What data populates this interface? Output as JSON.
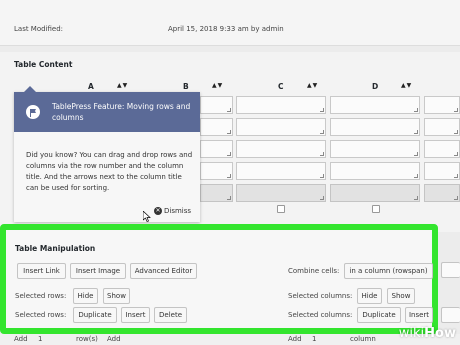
{
  "meta": {
    "last_modified_label": "Last Modified:",
    "last_modified_value": "April 15, 2018 9:33 am by admin"
  },
  "table_content": {
    "heading": "Table Content",
    "columns": [
      "A",
      "B",
      "C",
      "D"
    ],
    "sort_arrows": "▲▼"
  },
  "popup": {
    "title": "TablePress Feature: Moving rows and columns",
    "body": "Did you know? You can drag and drop rows and columns via the row number and the column title. And the arrows next to the column title can be used for sorting.",
    "dismiss": "Dismiss"
  },
  "manipulation": {
    "heading": "Table Manipulation",
    "insert_link": "Insert Link",
    "insert_image": "Insert Image",
    "advanced_editor": "Advanced Editor",
    "combine_cells_label": "Combine cells:",
    "combine_cells_button": "in a column (rowspan)",
    "selected_rows_label": "Selected rows:",
    "selected_columns_label": "Selected columns:",
    "hide": "Hide",
    "show": "Show",
    "duplicate": "Duplicate",
    "insert": "Insert",
    "delete": "Delete"
  },
  "bottom": {
    "add_label": "Add",
    "add_rows_value": "1",
    "rows_suffix": "row(s)",
    "add_button": "Add",
    "add_cols_value": "1",
    "cols_suffix": "column"
  },
  "watermark": {
    "wiki": "wiki",
    "how": "How"
  },
  "colors": {
    "highlight": "#33e52e",
    "popup_header": "#5b6a97"
  }
}
